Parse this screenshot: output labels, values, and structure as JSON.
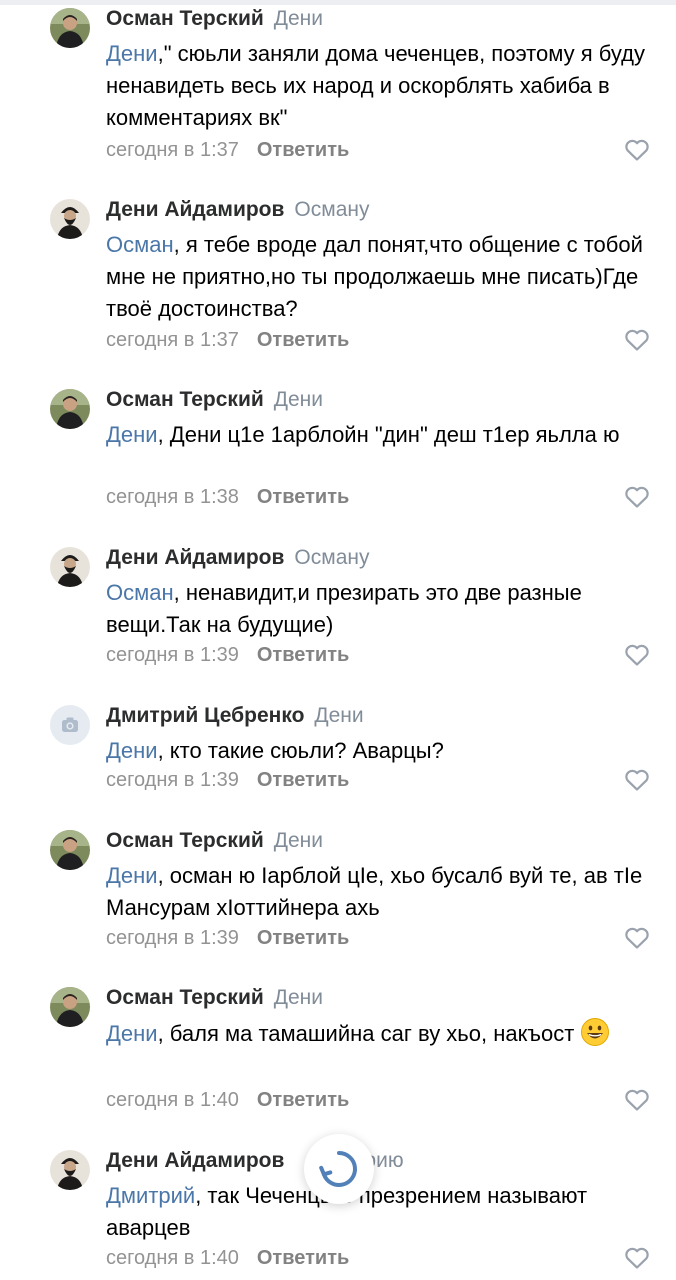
{
  "colors": {
    "mention": "#4a76a8",
    "author": "#2c2d2e",
    "muted": "#818c99",
    "like_icon": "#99a2ad",
    "spinner": "#5181b8"
  },
  "ui": {
    "like_icon": "heart-outline-icon",
    "loading_icon": "loading-spinner-icon"
  },
  "comments": [
    {
      "author": "Осман Терский",
      "reply_to": "Дени",
      "mention": "Дени",
      "text": ",\" сюьли заняли дома чеченцев, поэтому я буду ненавидеть весь их народ и оскорблять хабиба в комментариях вк\"",
      "time": "сегодня в 1:37",
      "reply_label": "Ответить",
      "avatar": "photo-man-outdoor"
    },
    {
      "author": "Дени Айдамиров",
      "reply_to": "Осману",
      "mention": "Осман",
      "text": ", я тебе вроде дал понят,что общение с тобой мне не приятно,но ты продолжаешь мне писать)Где твоё достоинства?",
      "time": "сегодня в 1:37",
      "reply_label": "Ответить",
      "avatar": "photo-bearded-man"
    },
    {
      "author": "Осман Терский",
      "reply_to": "Дени",
      "mention": "Дени",
      "text": ", Дени ц1е 1арблойн \"дин\" деш т1ер яьлла ю",
      "time": "сегодня в 1:38",
      "reply_label": "Ответить",
      "avatar": "photo-man-outdoor"
    },
    {
      "author": "Дени Айдамиров",
      "reply_to": "Осману",
      "mention": "Осман",
      "text": ", ненавидит,и презирать это две разные вещи.Так на будущие)",
      "time": "сегодня в 1:39",
      "reply_label": "Ответить",
      "avatar": "photo-bearded-man"
    },
    {
      "author": "Дмитрий Цебренко",
      "reply_to": "Дени",
      "mention": "Дени",
      "text": ", кто такие сюьли? Аварцы?",
      "time": "сегодня в 1:39",
      "reply_label": "Ответить",
      "avatar": "camera-placeholder"
    },
    {
      "author": "Осман Терский",
      "reply_to": "Дени",
      "mention": "Дени",
      "text": ", осман ю Iарблой цIе, хьо бусалб вуй те, ав тIе Мансурам хIоттийнера ахь",
      "time": "сегодня в 1:39",
      "reply_label": "Ответить",
      "avatar": "photo-man-outdoor"
    },
    {
      "author": "Осман Терский",
      "reply_to": "Дени",
      "mention": "Дени",
      "text": ", баля ма тамашийна саг ву хьо, накъост",
      "emoji": "grinning-face-emoji",
      "time": "сегодня в 1:40",
      "reply_label": "Ответить",
      "avatar": "photo-man-outdoor"
    },
    {
      "author": "Дени Айдамиров",
      "reply_to": "рию",
      "mention": "Дмитрий",
      "text": ", так Чеченцы с презрением называют аварцев",
      "time": "сегодня в 1:40",
      "reply_label": "Ответить",
      "avatar": "photo-bearded-man"
    }
  ]
}
